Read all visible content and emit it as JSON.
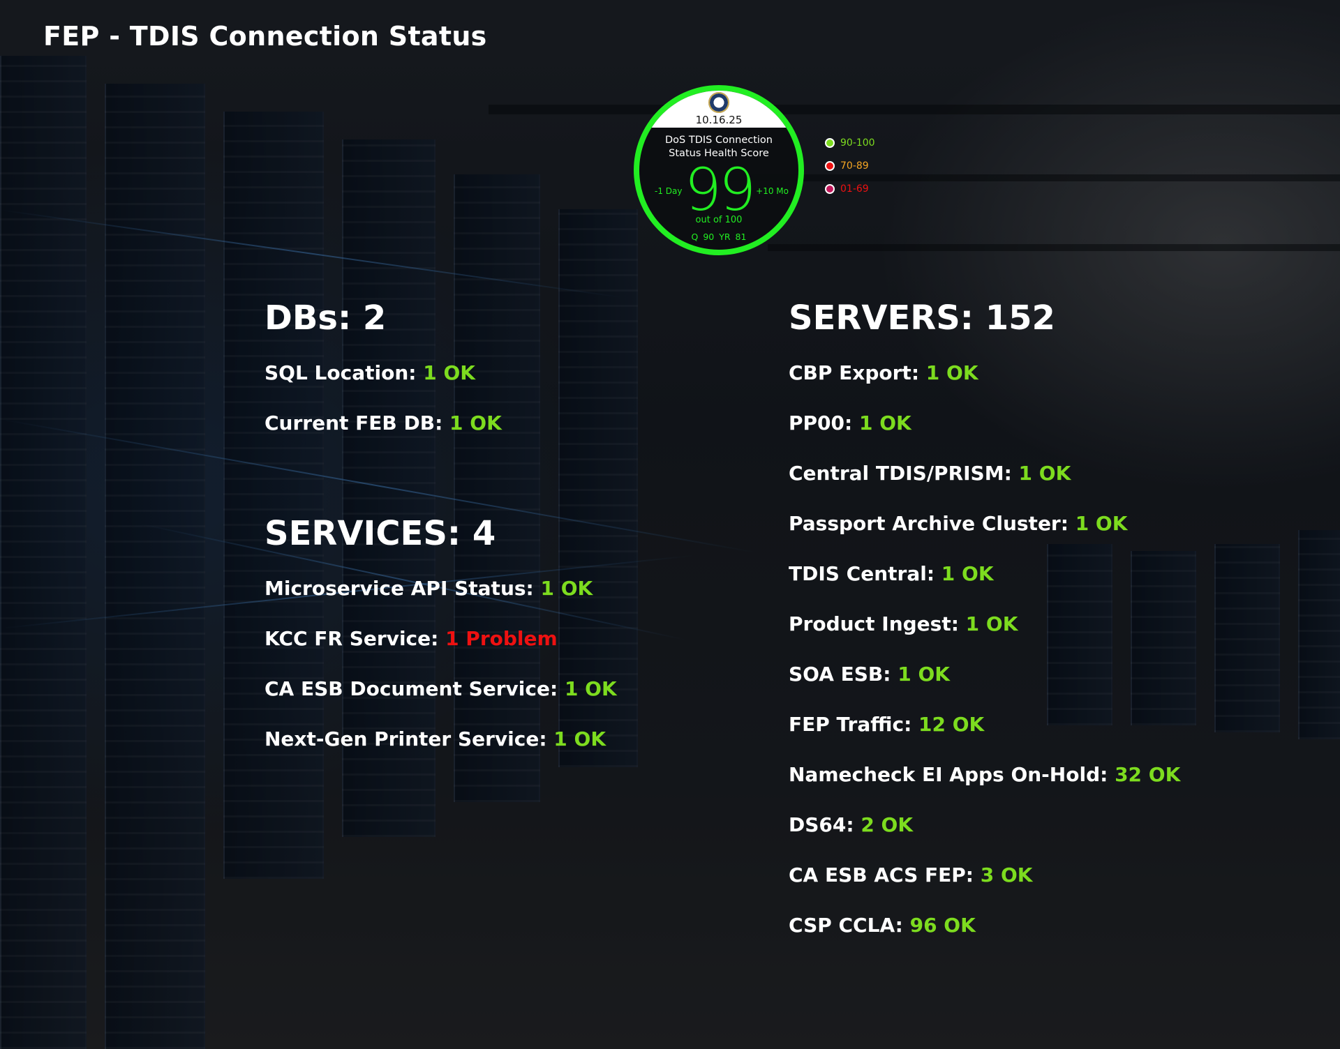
{
  "title": "FEP - TDIS Connection Status",
  "colors": {
    "ok": "#7ddc1f",
    "problem": "#ee1111",
    "gauge": "#22ee22"
  },
  "gauge": {
    "date": "10.16.25",
    "label_line1": "DoS TDIS Connection",
    "label_line2": "Status Health Score",
    "score": "99",
    "left_caption": "-1 Day",
    "right_caption": "+10 Mo",
    "out_of": "out of 100",
    "q_yr": "Q 90 YR 81",
    "seal_icon": "department-seal-icon"
  },
  "legend": [
    {
      "label": "90-100",
      "color": "#7ddc1f",
      "text_color": "#7ddc1f"
    },
    {
      "label": "70-89",
      "color": "#ee1111",
      "text_color": "#f5a623"
    },
    {
      "label": "01-69",
      "color": "#c2185b",
      "text_color": "#ee1111"
    }
  ],
  "dbs": {
    "heading": "DBs: 2",
    "items": [
      {
        "label": "SQL Location:",
        "status": "1 OK",
        "state": "ok"
      },
      {
        "label": "Current FEB DB:",
        "status": "1 OK",
        "state": "ok"
      }
    ]
  },
  "services": {
    "heading": "SERVICES: 4",
    "items": [
      {
        "label": "Microservice API Status:",
        "status": "1 OK",
        "state": "ok"
      },
      {
        "label": "KCC FR Service:",
        "status": "1 Problem",
        "state": "problem"
      },
      {
        "label": "CA ESB Document Service:",
        "status": "1 OK",
        "state": "ok"
      },
      {
        "label": "Next-Gen Printer Service:",
        "status": "1 OK",
        "state": "ok"
      }
    ]
  },
  "servers": {
    "heading": "SERVERS: 152",
    "items": [
      {
        "label": "CBP Export:",
        "status": "1 OK",
        "state": "ok"
      },
      {
        "label": "PP00:",
        "status": "1 OK",
        "state": "ok"
      },
      {
        "label": "Central TDIS/PRISM:",
        "status": "1 OK",
        "state": "ok"
      },
      {
        "label": "Passport Archive Cluster:",
        "status": "1 OK",
        "state": "ok"
      },
      {
        "label": "TDIS Central:",
        "status": "1 OK",
        "state": "ok"
      },
      {
        "label": "Product Ingest:",
        "status": "1 OK",
        "state": "ok"
      },
      {
        "label": "SOA ESB:",
        "status": "1 OK",
        "state": "ok"
      },
      {
        "label": "FEP Traffic:",
        "status": "12 OK",
        "state": "ok"
      },
      {
        "label": "Namecheck EI Apps On-Hold:",
        "status": "32 OK",
        "state": "ok"
      },
      {
        "label": "DS64:",
        "status": "2 OK",
        "state": "ok"
      },
      {
        "label": "CA ESB ACS FEP:",
        "status": "3 OK",
        "state": "ok"
      },
      {
        "label": "CSP CCLA:",
        "status": "96 OK",
        "state": "ok"
      }
    ]
  }
}
